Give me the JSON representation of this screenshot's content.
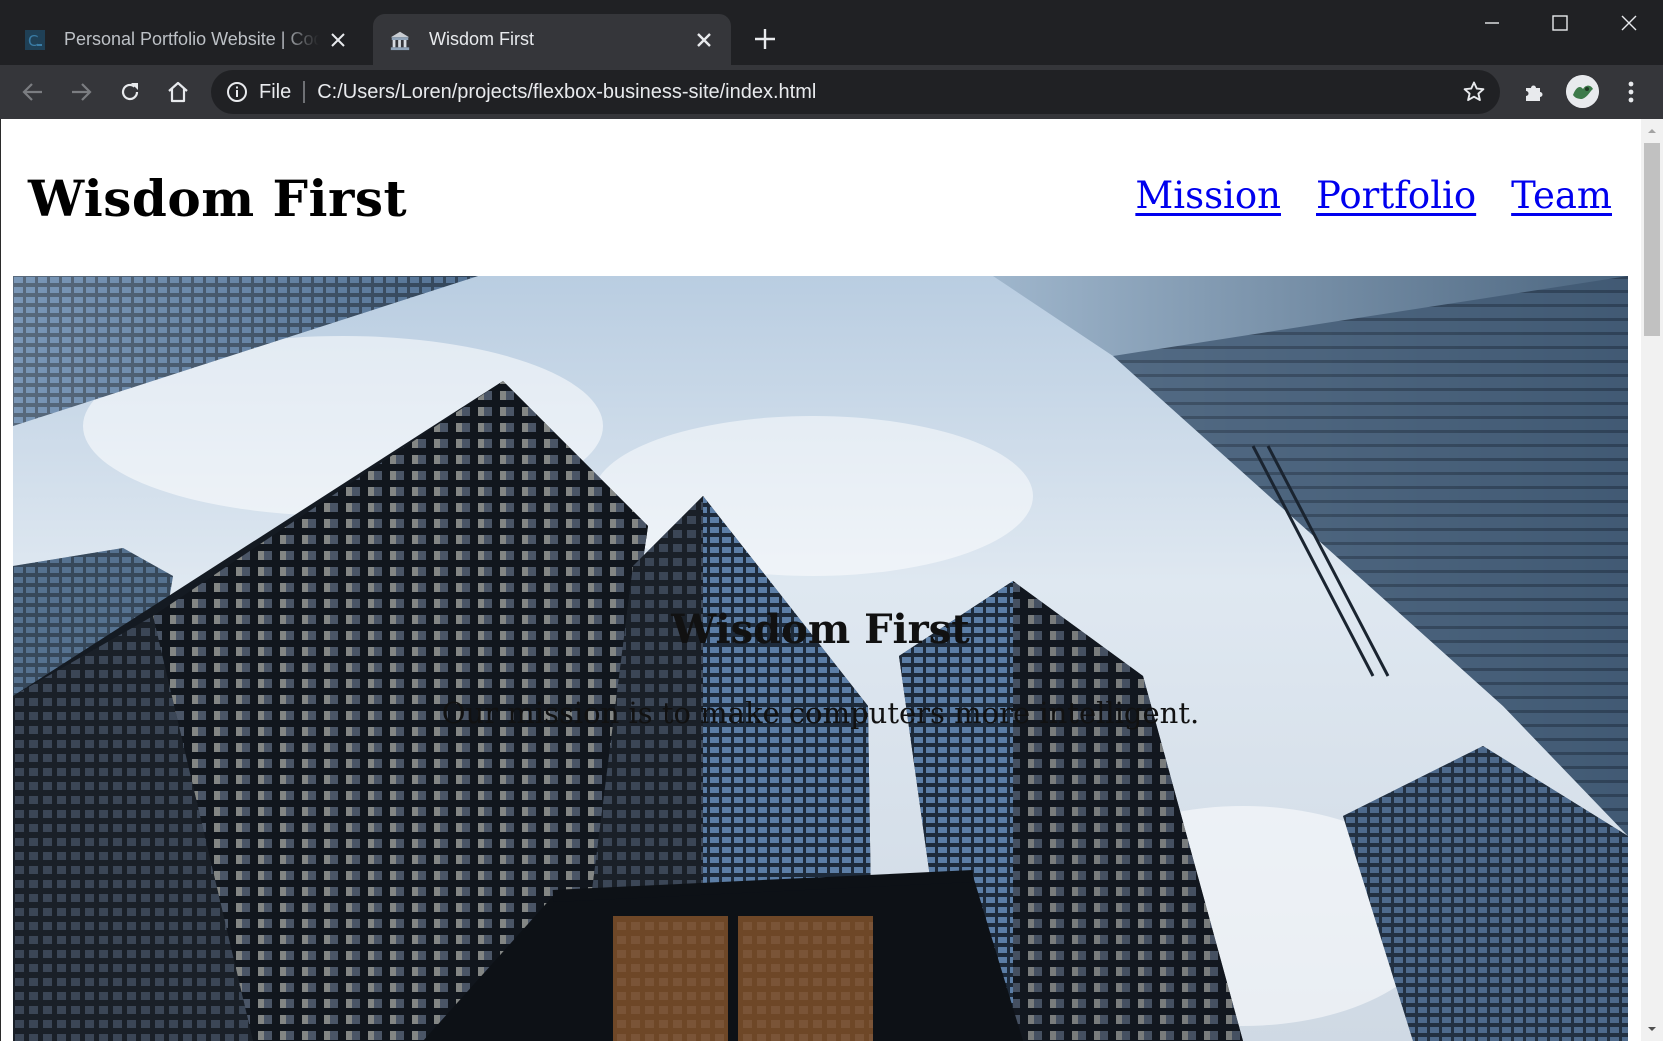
{
  "browser": {
    "tabs": [
      {
        "title": "Personal Portfolio Website | Codecademy",
        "active": false
      },
      {
        "title": "Wisdom First",
        "active": true
      }
    ],
    "address": {
      "scheme_label": "File",
      "url": "C:/Users/Loren/projects/flexbox-business-site/index.html"
    }
  },
  "page": {
    "brand": "Wisdom First",
    "nav": [
      "Mission",
      "Portfolio",
      "Team"
    ],
    "hero": {
      "title": "Wisdom First",
      "subtitle": "Our mission is to make computers more intelligent."
    }
  },
  "colors": {
    "link": "#0000ee",
    "chrome_dark": "#202124",
    "chrome_toolbar": "#35363a"
  },
  "icons": [
    "codecademy-favicon",
    "building-favicon",
    "close-icon",
    "plus-icon",
    "minimize-icon",
    "maximize-icon",
    "window-close-icon",
    "back-icon",
    "forward-icon",
    "reload-icon",
    "home-icon",
    "info-icon",
    "star-icon",
    "extensions-icon",
    "menu-icon"
  ]
}
